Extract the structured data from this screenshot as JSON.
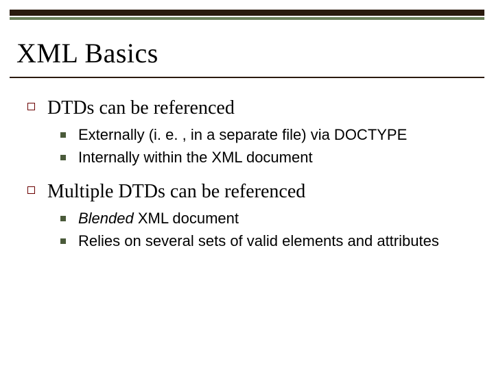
{
  "title": "XML Basics",
  "items": [
    {
      "text": "DTDs can be referenced",
      "subitems": [
        {
          "text": "Externally (i. e. , in a separate file) via DOCTYPE"
        },
        {
          "text": "Internally within the XML document"
        }
      ]
    },
    {
      "text": "Multiple DTDs can be referenced",
      "subitems": [
        {
          "italic_lead": "Blended",
          "rest": " XML document"
        },
        {
          "text": "Relies on several sets of valid elements and attributes"
        }
      ]
    }
  ]
}
